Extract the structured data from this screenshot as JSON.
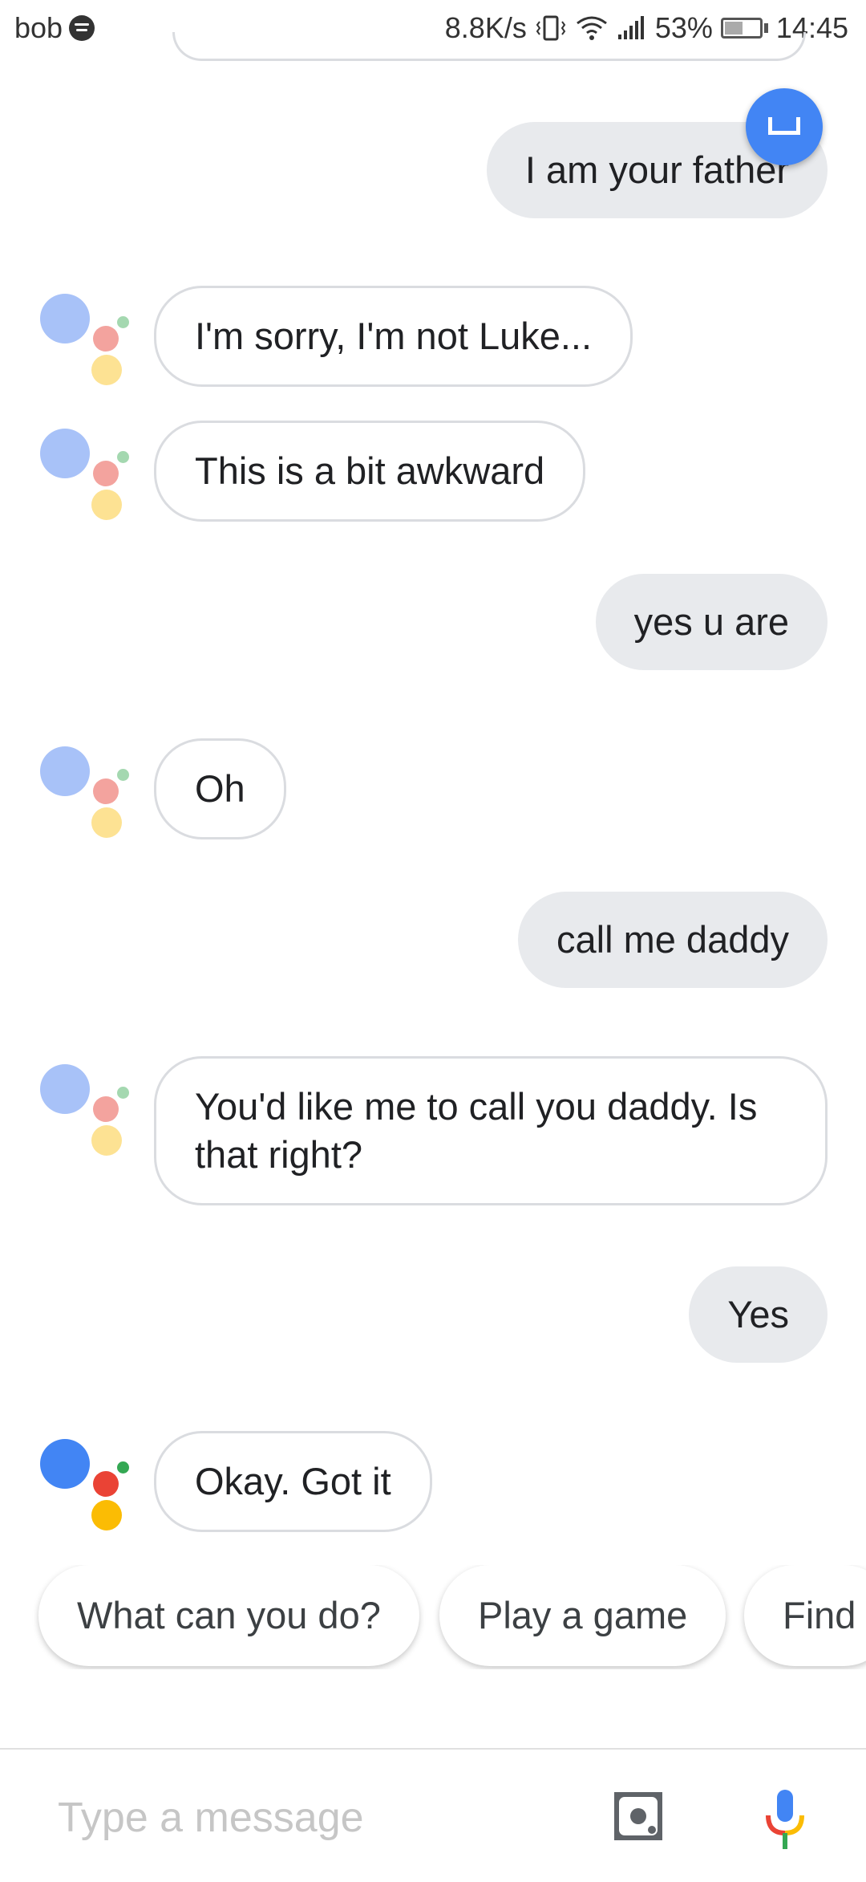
{
  "status_bar": {
    "carrier": "bob",
    "net_speed": "8.8K/s",
    "battery": "53%",
    "battery_level": 0.53,
    "time": "14:45"
  },
  "messages": [
    {
      "from": "user",
      "text": "I am your father"
    },
    {
      "from": "assistant",
      "text": "I'm sorry, I'm not Luke..."
    },
    {
      "from": "assistant",
      "text": "This is a bit awkward"
    },
    {
      "from": "user",
      "text": "yes u are"
    },
    {
      "from": "assistant",
      "text": "Oh"
    },
    {
      "from": "user",
      "text": "call me daddy"
    },
    {
      "from": "assistant",
      "text": "You'd like me to call you daddy. Is that right?"
    },
    {
      "from": "user",
      "text": "Yes"
    },
    {
      "from": "assistant",
      "text": "Okay. Got it"
    }
  ],
  "suggestions": [
    "What can you do?",
    "Play a game",
    "Find"
  ],
  "input": {
    "placeholder": "Type a message",
    "value": ""
  },
  "icons": {
    "keyboard_fab": "keyboard-tray-icon",
    "lens": "lens-icon",
    "mic": "mic-icon"
  },
  "colors": {
    "google_blue": "#4285f4",
    "google_red": "#ea4335",
    "google_yellow": "#fbbc04",
    "google_green": "#34a853",
    "user_bubble": "#e8eaed"
  }
}
